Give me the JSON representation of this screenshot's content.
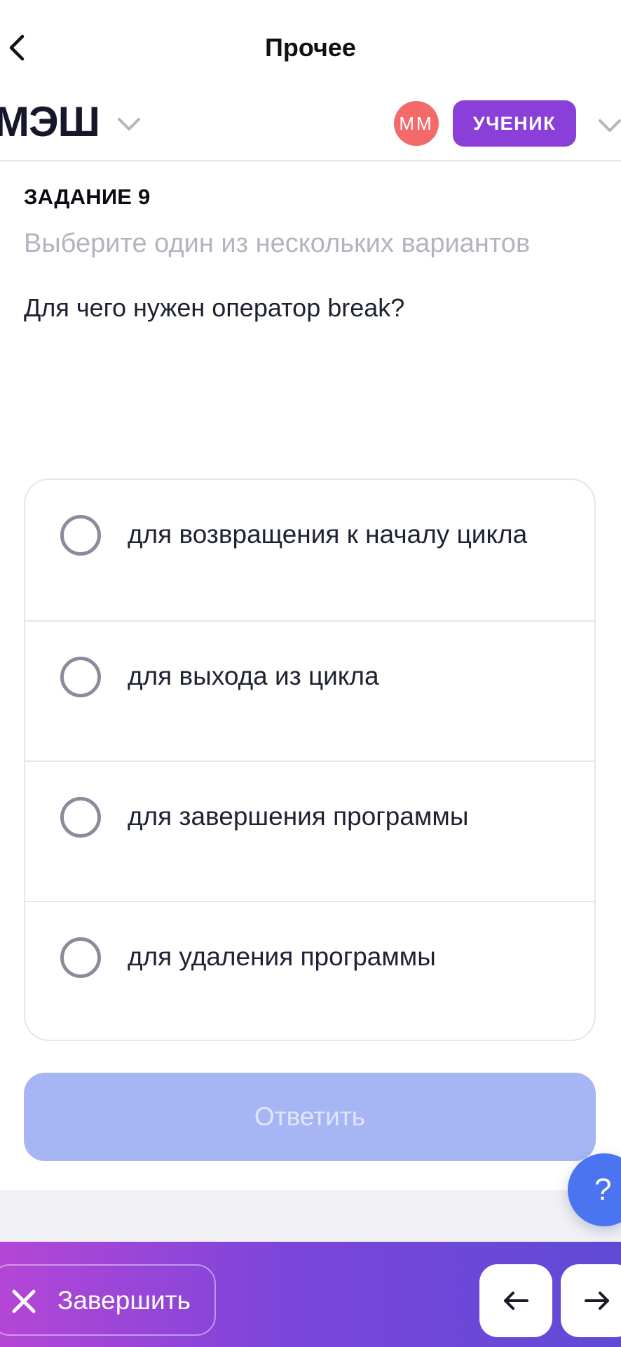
{
  "titlebar": {
    "title": "Прочее",
    "back_icon": "chevron-left-icon"
  },
  "app_header": {
    "logo": "МЭШ",
    "avatar_initials": "ММ",
    "role_label": "УЧЕНИК",
    "colors": {
      "avatar": "#f36a6a",
      "role_badge": "#8b3fd9"
    }
  },
  "task": {
    "number_label": "ЗАДАНИЕ 9",
    "hint": "Выберите один из нескольких вариантов",
    "question": "Для чего нужен оператор break?",
    "options": [
      {
        "label": "для возвращения к началу цикла",
        "selected": false
      },
      {
        "label": "для выхода из цикла",
        "selected": false
      },
      {
        "label": "для завершения программы",
        "selected": false
      },
      {
        "label": "для удаления программы",
        "selected": false
      }
    ],
    "answer_label": "Ответить",
    "answer_enabled": false
  },
  "help": {
    "label": "?"
  },
  "bottom_bar": {
    "finish_label": "Завершить",
    "finish_icon": "close-icon",
    "prev_icon": "arrow-left-icon",
    "next_icon": "arrow-right-icon"
  },
  "colors": {
    "accent_button_disabled": "#a6b6f5",
    "help_button": "#4a74f0",
    "bottom_gradient_start": "#b446d6",
    "bottom_gradient_end": "#5f4ad6"
  }
}
